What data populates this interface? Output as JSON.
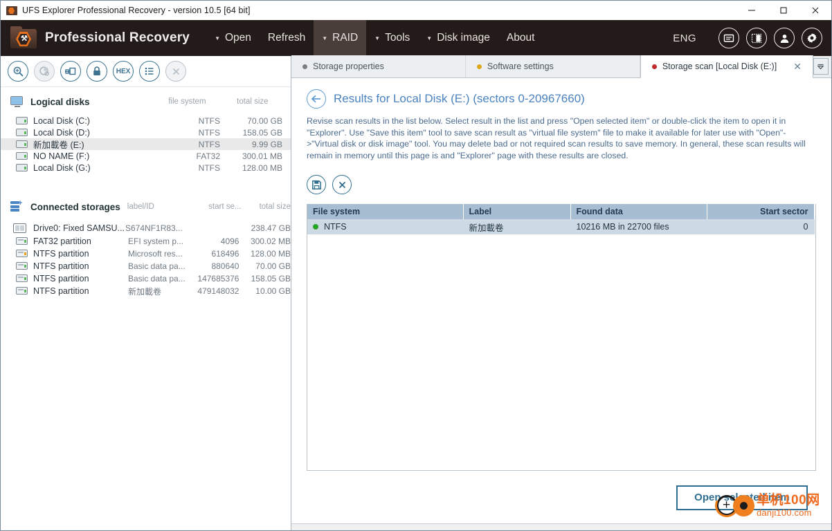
{
  "window": {
    "title": "UFS Explorer Professional Recovery - version 10.5 [64 bit]",
    "minimize_label": "—",
    "maximize_label": "□",
    "close_label": "✕"
  },
  "header": {
    "brand": "Professional Recovery",
    "logo_mark": "⚒",
    "menu": [
      {
        "label": "Open",
        "caret": "▼",
        "active": false
      },
      {
        "label": "Refresh",
        "caret": "",
        "active": false
      },
      {
        "label": "RAID",
        "caret": "▼",
        "active": true
      },
      {
        "label": "Tools",
        "caret": "▼",
        "active": false
      },
      {
        "label": "Disk image",
        "caret": "▼",
        "active": false
      },
      {
        "label": "About",
        "caret": "",
        "active": false
      }
    ],
    "language": "ENG",
    "icons": [
      {
        "name": "messages-icon",
        "glyph": "▤"
      },
      {
        "name": "panel-layout-icon",
        "glyph": "◧"
      },
      {
        "name": "user-account-icon",
        "glyph": "●"
      },
      {
        "name": "settings-gear-icon",
        "glyph": "⚙"
      }
    ]
  },
  "sidebar": {
    "toolbar": [
      {
        "name": "scan-icon",
        "glyph": "⚲",
        "state": "enabled"
      },
      {
        "name": "pie-analysis-icon",
        "glyph": "◔",
        "state": "disabled"
      },
      {
        "name": "clone-storage-icon",
        "glyph": "⧉",
        "state": "enabled"
      },
      {
        "name": "lock-icon",
        "glyph": "🔒",
        "state": "enabled"
      },
      {
        "name": "hex-viewer-icon",
        "glyph": "HEX",
        "state": "enabled"
      },
      {
        "name": "properties-list-icon",
        "glyph": "☰",
        "state": "enabled"
      },
      {
        "name": "close-storage-icon",
        "glyph": "✕",
        "state": "disabled"
      }
    ],
    "logical_disks": {
      "title": "Logical disks",
      "columns": {
        "fs": "file system",
        "size": "total size"
      },
      "rows": [
        {
          "name": "Local Disk (C:)",
          "fs": "NTFS",
          "size": "70.00 GB",
          "selected": false
        },
        {
          "name": "Local Disk (D:)",
          "fs": "NTFS",
          "size": "158.05 GB",
          "selected": false
        },
        {
          "name": "新加載卷 (E:)",
          "fs": "NTFS",
          "size": "9.99 GB",
          "selected": true
        },
        {
          "name": "NO NAME (F:)",
          "fs": "FAT32",
          "size": "300.01 MB",
          "selected": false
        },
        {
          "name": "Local Disk (G:)",
          "fs": "NTFS",
          "size": "128.00 MB",
          "selected": false
        }
      ]
    },
    "connected_storages": {
      "title": "Connected storages",
      "columns": {
        "label": "label/ID",
        "start": "start se...",
        "size": "total size"
      },
      "rows": [
        {
          "name": "Drive0: Fixed SAMSU...",
          "label": "S674NF1R83...",
          "start": "",
          "size": "238.47 GB",
          "type": "drive"
        },
        {
          "name": "FAT32 partition",
          "label": "EFI system p...",
          "start": "4096",
          "size": "300.02 MB",
          "type": "partition",
          "health": "green"
        },
        {
          "name": "NTFS partition",
          "label": "Microsoft res...",
          "start": "618496",
          "size": "128.00 MB",
          "type": "partition",
          "health": "amber"
        },
        {
          "name": "NTFS partition",
          "label": "Basic data pa...",
          "start": "880640",
          "size": "70.00 GB",
          "type": "partition",
          "health": "green"
        },
        {
          "name": "NTFS partition",
          "label": "Basic data pa...",
          "start": "147685376",
          "size": "158.05 GB",
          "type": "partition",
          "health": "green"
        },
        {
          "name": "NTFS partition",
          "label": "新加載卷",
          "start": "479148032",
          "size": "10.00 GB",
          "type": "partition",
          "health": "green"
        }
      ]
    }
  },
  "tabs": [
    {
      "label": "Storage properties",
      "dot_color": "#7d7d7d",
      "active": false
    },
    {
      "label": "Software settings",
      "dot_color": "#e0a61a",
      "active": false
    },
    {
      "label": "Storage scan [Local Disk (E:)]",
      "dot_color": "#c02b2b",
      "active": true,
      "close_label": "✕"
    }
  ],
  "tab_menu_glyph": "▽",
  "main": {
    "back_glyph": "←",
    "title": "Results for Local Disk (E:) (sectors 0-20967660)",
    "description": "Revise scan results in the list below. Select result in the list and press \"Open selected item\" or double-click the item to open it in \"Explorer\". Use \"Save this item\" tool to save scan result as \"virtual file system\" file to make it available for later use with \"Open\"->\"Virtual disk or disk image\" tool. You may delete bad or not required scan results to save memory. In general, these scan results will remain in memory until this page is and \"Explorer\" page with these results are closed.",
    "actions": [
      {
        "name": "save-this-item-button",
        "glyph": "💾"
      },
      {
        "name": "delete-scan-result-button",
        "glyph": "✕"
      }
    ],
    "table": {
      "columns": [
        "File system",
        "Label",
        "Found data",
        "Start sector",
        ""
      ],
      "rows": [
        {
          "file_system": "NTFS",
          "status_color": "#27a327",
          "label": "新加載卷",
          "found_data": "10216 MB in 22700 files",
          "start_sector": "0",
          "extra": ""
        }
      ]
    },
    "open_button": "Open selected item"
  },
  "watermark": {
    "cn": "单机100网",
    "en": "danji100.com",
    "color": "#ef6a1f"
  }
}
